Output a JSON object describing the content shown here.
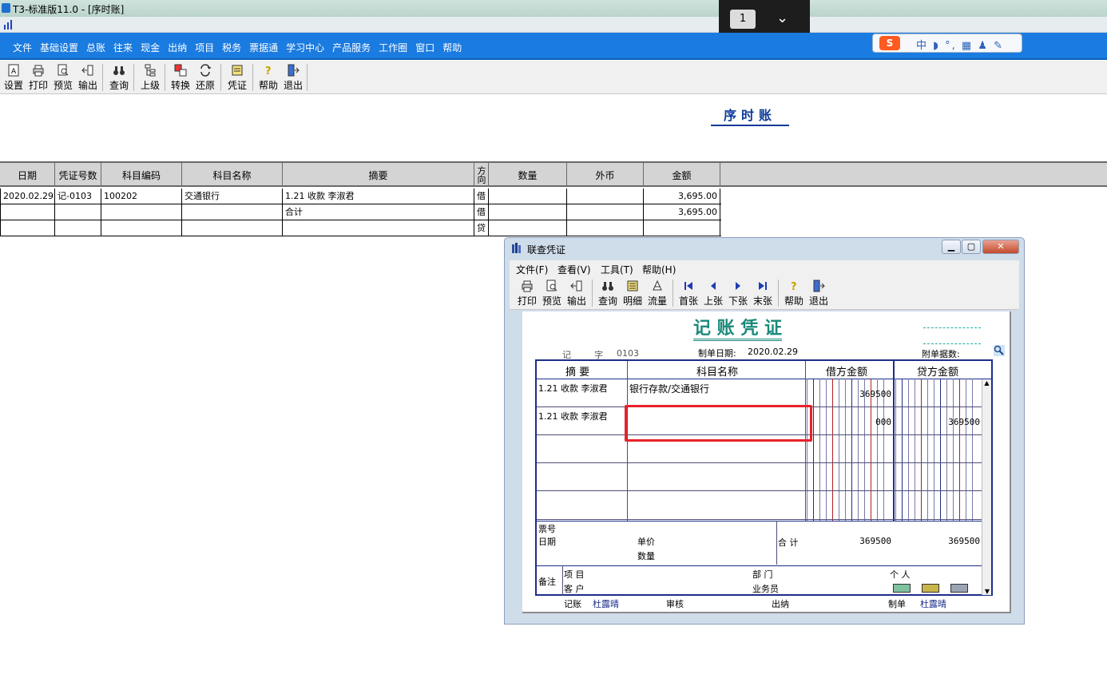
{
  "window": {
    "title": "T3-标准版11.0 - [序时账]"
  },
  "page_indicator": {
    "number": "1"
  },
  "ime": {
    "logo": "S",
    "text": "中 ◗ °, ▦ ♟ ✎"
  },
  "menu": [
    "文件",
    "基础设置",
    "总账",
    "往来",
    "现金",
    "出纳",
    "项目",
    "税务",
    "票据通",
    "学习中心",
    "产品服务",
    "工作圈",
    "窗口",
    "帮助"
  ],
  "toolbar": {
    "set": "设置",
    "print": "打印",
    "preview": "预览",
    "export": "输出",
    "query": "查询",
    "up": "上级",
    "convert": "转换",
    "restore": "还原",
    "voucher": "凭证",
    "help": "帮助",
    "exit": "退出"
  },
  "report": {
    "title": "序时账"
  },
  "ledger": {
    "headers": [
      "日期",
      "凭证号数",
      "科目编码",
      "科目名称",
      "摘要",
      "方向",
      "数量",
      "外币",
      "金额"
    ],
    "rows": [
      [
        "2020.02.29",
        "记-0103",
        "100202",
        "交通银行",
        "1.21 收款 李淑君",
        "借",
        "",
        "",
        "3,695.00"
      ],
      [
        "",
        "",
        "",
        "",
        "合计",
        "借",
        "",
        "",
        "3,695.00"
      ],
      [
        "",
        "",
        "",
        "",
        "",
        "贷",
        "",
        "",
        ""
      ]
    ]
  },
  "voucher_window": {
    "title": "联查凭证",
    "menu": [
      "文件(F)",
      "查看(V)",
      "工具(T)",
      "帮助(H)"
    ],
    "toolbar": {
      "print": "打印",
      "preview": "预览",
      "export": "输出",
      "query": "查询",
      "detail": "明细",
      "flow": "流量",
      "first": "首张",
      "prev": "上张",
      "next": "下张",
      "last": "末张",
      "help": "帮助",
      "exit": "退出"
    },
    "voucher": {
      "title": "记 账 凭 证",
      "type_label": "记",
      "zi_label": "字",
      "number": "0103",
      "date_label": "制单日期:",
      "date": "2020.02.29",
      "attach_label": "附单据数:",
      "col_summary": "摘 要",
      "col_account": "科目名称",
      "col_debit": "借方金额",
      "col_credit": "贷方金额",
      "lines": [
        {
          "summary": "1.21 收款 李淑君",
          "account": "银行存款/交通银行",
          "debit": "369500",
          "credit": ""
        },
        {
          "summary": "1.21 收款 李淑君",
          "account": "",
          "debit": "000",
          "credit": "369500"
        }
      ],
      "ticket_no_label": "票号",
      "date_label2": "日期",
      "unit_price_label": "单价",
      "quantity_label": "数量",
      "total_label": "合 计",
      "total_debit": "369500",
      "total_credit": "369500",
      "remark_label": "备注",
      "project_label": "项 目",
      "customer_label": "客 户",
      "dept_label": "部 门",
      "salesman_label": "业务员",
      "person_label": "个 人",
      "bookkeeper_label": "记账",
      "bookkeeper": "杜露晴",
      "review_label": "审核",
      "cashier_label": "出纳",
      "maker_label": "制单",
      "maker": "杜露晴"
    }
  }
}
